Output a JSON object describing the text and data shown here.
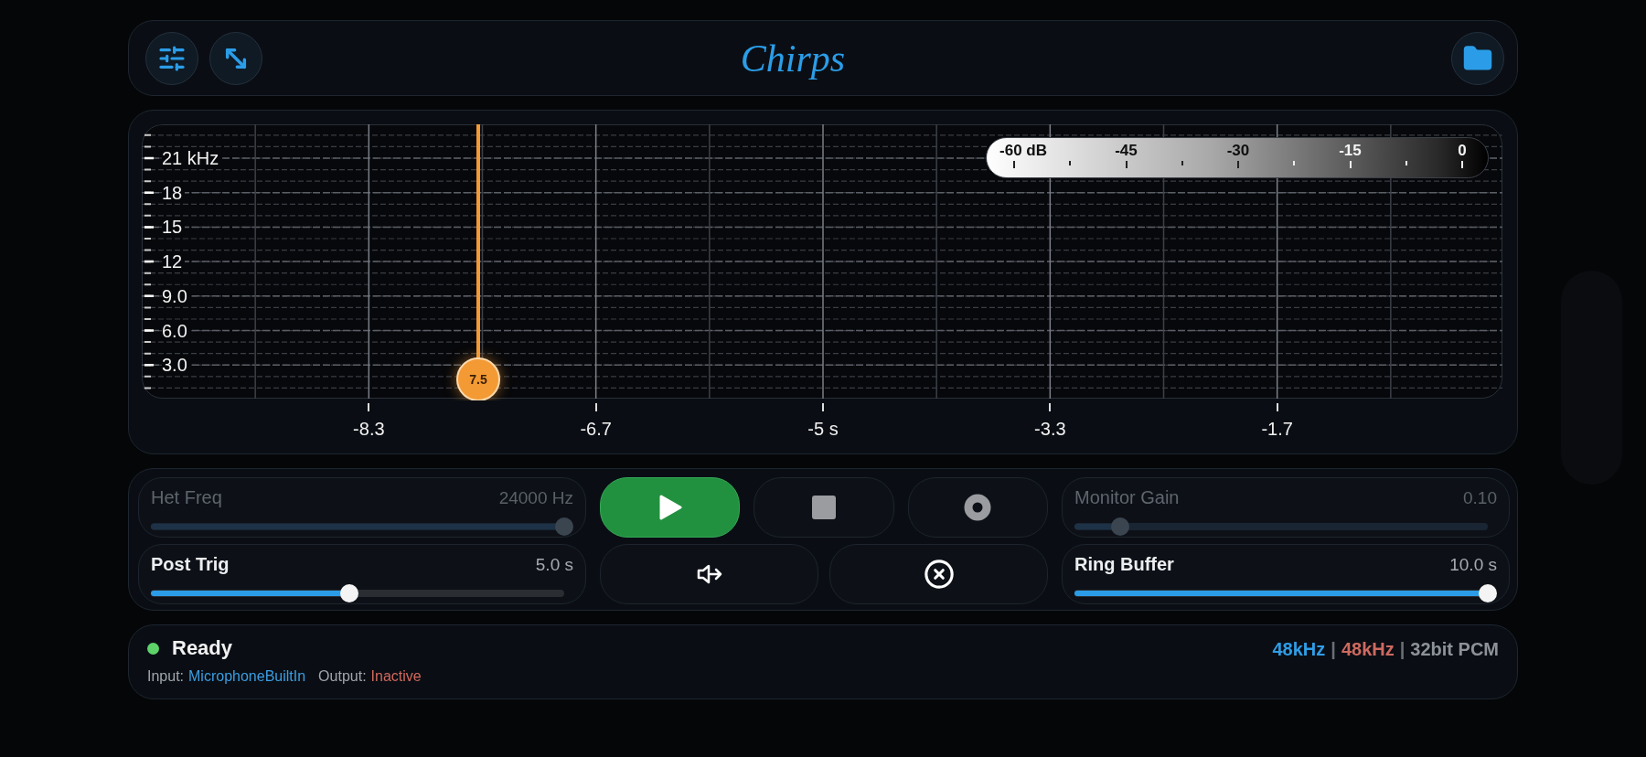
{
  "header": {
    "title": "Chirps"
  },
  "spectrogram": {
    "freq_labels": [
      "21 kHz",
      "18",
      "15",
      "12",
      "9.0",
      "6.0",
      "3.0"
    ],
    "time_labels": [
      "-8.3",
      "-6.7",
      "-5 s",
      "-3.3",
      "-1.7"
    ],
    "colorbar_labels": [
      "-60 dB",
      "-45",
      "-30",
      "-15",
      "0"
    ],
    "cursor": {
      "label": "7.5",
      "level": 0.247
    }
  },
  "controls": {
    "sliders_left": [
      {
        "label": "Het Freq",
        "value": "24000 Hz",
        "level": 1,
        "disabled": true
      },
      {
        "label": "Post Trig",
        "value": "5.0 s",
        "level": 0.48,
        "disabled": false
      }
    ],
    "sliders_right": [
      {
        "label": "Monitor Gain",
        "value": "0.10",
        "level": 0.11,
        "disabled": true
      },
      {
        "label": "Ring Buffer",
        "value": "10.0 s",
        "level": 1,
        "disabled": false
      }
    ],
    "transport": [
      {
        "kind": "play",
        "active": true
      },
      {
        "kind": "stop",
        "active": false
      },
      {
        "kind": "record",
        "active": false
      }
    ],
    "actions": [
      {
        "kind": "monitor-out"
      },
      {
        "kind": "clear"
      }
    ]
  },
  "status": {
    "state": "Ready",
    "io": [
      {
        "kind": "input",
        "label": "Input:",
        "value": "MicrophoneBuiltIn"
      },
      {
        "kind": "output",
        "label": "Output:",
        "value": "Inactive"
      }
    ],
    "format": [
      {
        "kind": "input",
        "text": "48kHz"
      },
      {
        "kind": "sep",
        "text": "|"
      },
      {
        "kind": "output",
        "text": "48kHz"
      },
      {
        "kind": "sep",
        "text": "|"
      },
      {
        "kind": "format",
        "text": "32bit PCM"
      }
    ]
  }
}
